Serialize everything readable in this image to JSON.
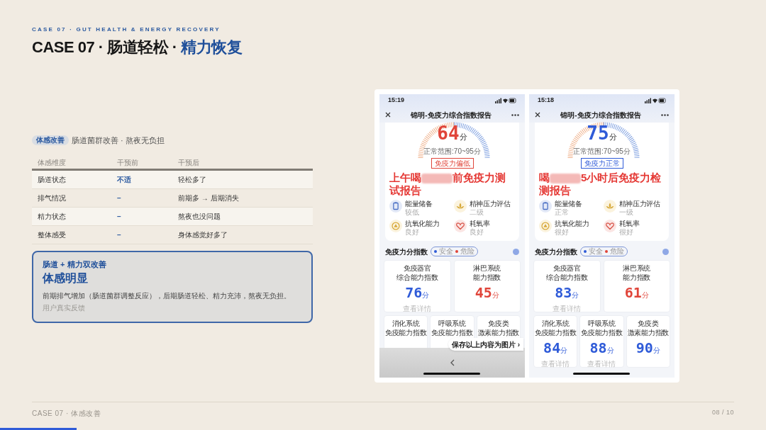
{
  "header": {
    "eyebrow": "CASE 07 · GUT HEALTH & ENERGY RECOVERY",
    "title_main": "CASE 07 · 肠道轻松 · ",
    "title_accent": "精力恢复"
  },
  "summary": {
    "tag": "体感改善",
    "subtitle": "肠道菌群改善 · 熬夜无负担"
  },
  "table": {
    "columns": [
      "体感维度",
      "干预前",
      "干预后"
    ],
    "rows": [
      {
        "cells": [
          "肠道状态",
          "不适",
          "轻松多了"
        ]
      },
      {
        "cells": [
          "排气情况",
          "–",
          "前期多 → 后期消失"
        ]
      },
      {
        "cells": [
          "精力状态",
          "–",
          "熬夜也没问题"
        ]
      },
      {
        "cells": [
          "整体感受",
          "–",
          "身体感觉好多了"
        ]
      }
    ]
  },
  "callout": {
    "kicker": "肠道 + 精力双改善",
    "headline": "体感明显",
    "body": "前期排气增加（肠道菌群调整反应），后期肠道轻松、精力充沛，熬夜无负担。",
    "source": "用户真实反馈"
  },
  "screenshots": [
    {
      "time": "15:19",
      "title": "锦明-免疫力综合指数报告",
      "score": {
        "value": "64",
        "unit": "分",
        "kind": "danger"
      },
      "range": "正常范围:70~95分",
      "badge": "免疫力偏低",
      "caption_before": "上午喝",
      "caption_after": "前免疫力测试报告",
      "metrics": [
        {
          "name": "能量储备",
          "value": "较低"
        },
        {
          "name": "精神压力评估",
          "value": "二级"
        },
        {
          "name": "抗氧化能力",
          "value": "良好"
        },
        {
          "name": "耗氧率",
          "value": "良好"
        }
      ],
      "section": "免疫力分指数",
      "legend": [
        {
          "label": "安全",
          "color": "#2f5bd8"
        },
        {
          "label": "危险",
          "color": "#e0453a"
        }
      ],
      "cards": [
        {
          "lines": [
            "免疫器官",
            "综合能力指数"
          ],
          "score": "76",
          "unit": "分",
          "kind": "safe",
          "link": "查看详情"
        },
        {
          "lines": [
            "淋巴系统",
            "能力指数"
          ],
          "score": "45",
          "unit": "分",
          "kind": "danger"
        }
      ],
      "small_cards": [
        {
          "lines": [
            "消化系统",
            "免疫能力指数"
          ]
        },
        {
          "lines": [
            "呼吸系统",
            "免疫能力指数"
          ]
        },
        {
          "lines": [
            "免疫类",
            "激素能力指数"
          ]
        }
      ],
      "save_bar": {
        "label": "保存以上内容为图片 ›"
      }
    },
    {
      "time": "15:18",
      "title": "锦明-免疫力综合指数报告",
      "score": {
        "value": "75",
        "unit": "分",
        "kind": "safe"
      },
      "range": "正常范围:70~95分",
      "badge": "免疫力正常",
      "caption_before": "喝",
      "caption_after": "5小时后免疫力检测报告",
      "metrics": [
        {
          "name": "能量储备",
          "value": "正常"
        },
        {
          "name": "精神压力评估",
          "value": "一级"
        },
        {
          "name": "抗氧化能力",
          "value": "很好"
        },
        {
          "name": "耗氧率",
          "value": "很好"
        }
      ],
      "section": "免疫力分指数",
      "legend": [
        {
          "label": "安全",
          "color": "#2f5bd8"
        },
        {
          "label": "危险",
          "color": "#e0453a"
        }
      ],
      "cards": [
        {
          "lines": [
            "免疫器官",
            "综合能力指数"
          ],
          "score": "83",
          "unit": "分",
          "kind": "safe",
          "link": "查看详情"
        },
        {
          "lines": [
            "淋巴系统",
            "能力指数"
          ],
          "score": "61",
          "unit": "分",
          "kind": "danger"
        }
      ],
      "small_cards": [
        {
          "lines": [
            "消化系统",
            "免疫能力指数"
          ],
          "score": "84",
          "unit": "分",
          "kind": "safe",
          "link": "查看详情"
        },
        {
          "lines": [
            "呼吸系统",
            "免疫能力指数"
          ],
          "score": "88",
          "unit": "分",
          "kind": "safe",
          "link": "查看详情"
        },
        {
          "lines": [
            "免疫类",
            "激素能力指数"
          ],
          "score": "90",
          "unit": "分",
          "kind": "safe"
        }
      ]
    }
  ],
  "footer": {
    "label": "CASE 07 · 体感改善",
    "page": "08 / 10",
    "progress": {
      "level": 0.1
    }
  }
}
